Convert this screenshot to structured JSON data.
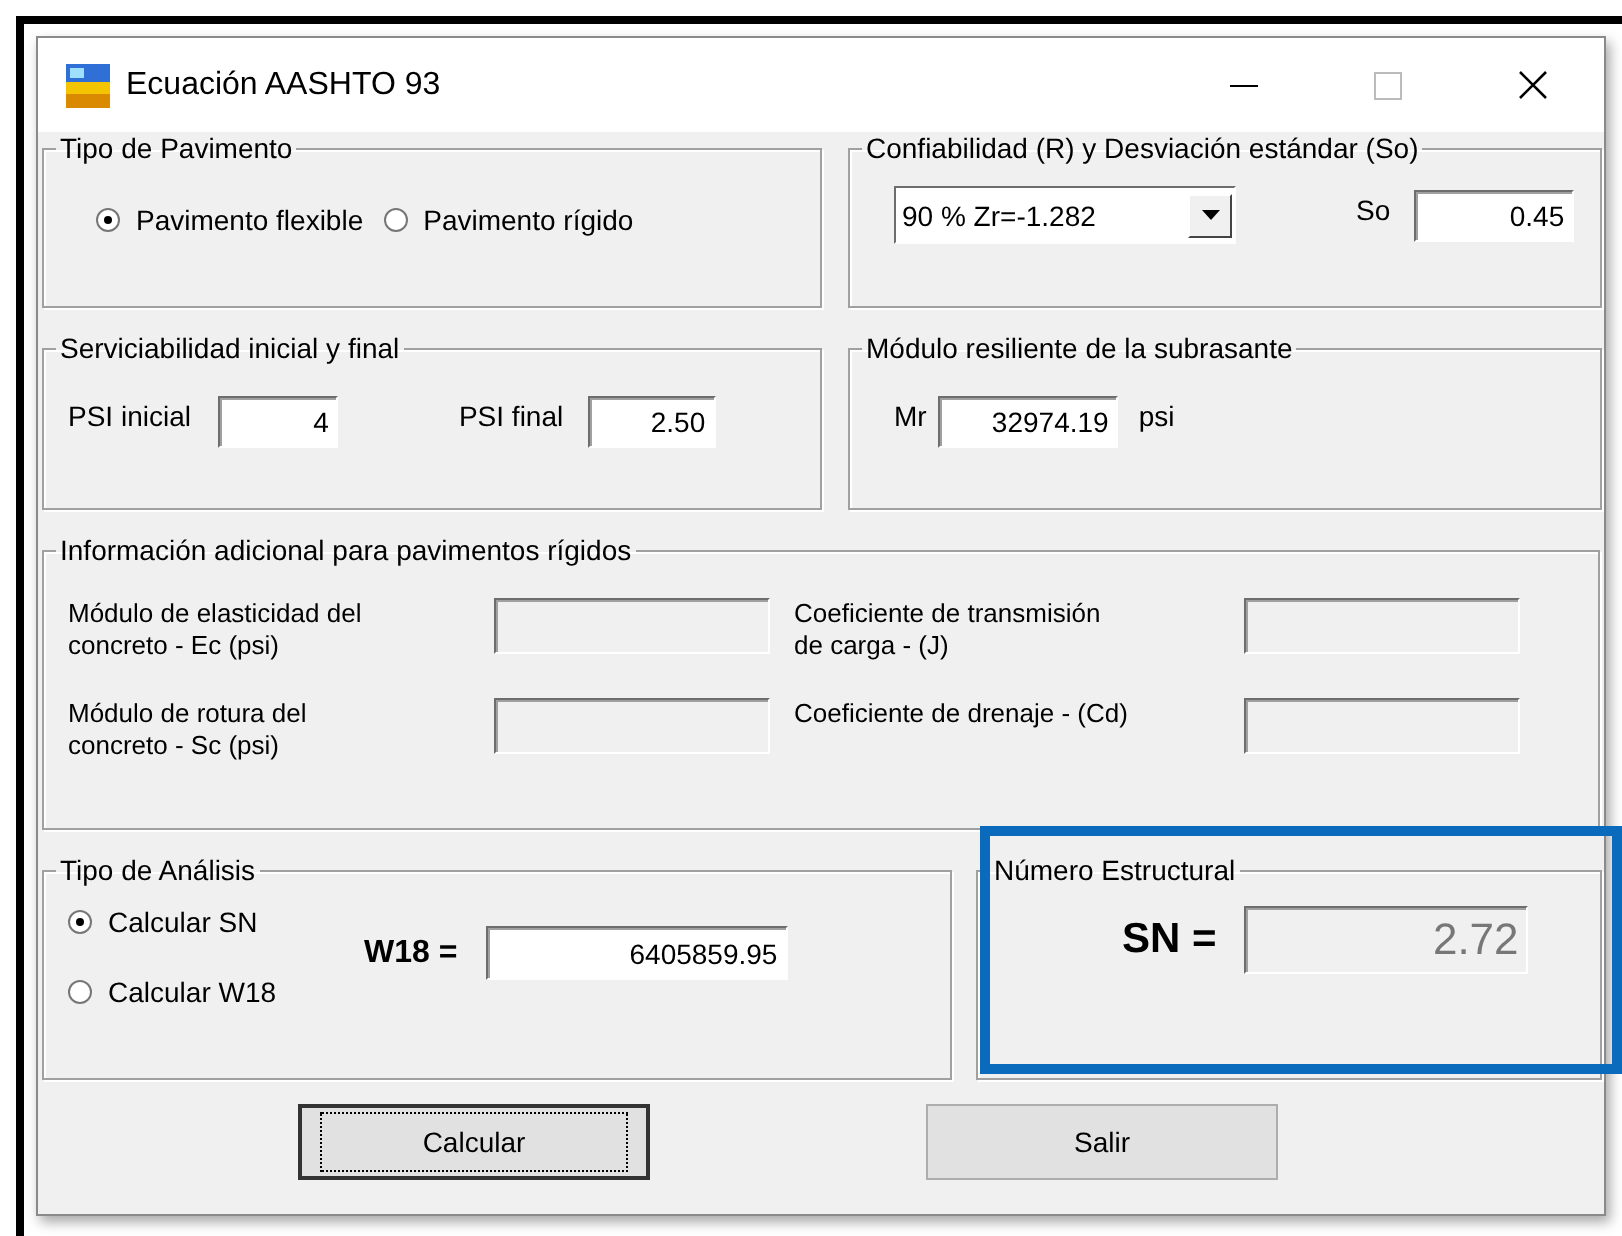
{
  "window": {
    "title": "Ecuación AASHTO 93"
  },
  "tipo_de_pavimento": {
    "title": "Tipo de Pavimento",
    "options": [
      {
        "label": "Pavimento flexible",
        "selected": true
      },
      {
        "label": "Pavimento rígido",
        "selected": false
      }
    ]
  },
  "confiabilidad": {
    "title": "Confiabilidad (R) y Desviación estándar (So)",
    "dropdown": {
      "value": "90 %  Zr=-1.282"
    },
    "so": {
      "label": "So",
      "value": "0.45"
    }
  },
  "serviciabilidad": {
    "title": "Serviciabilidad inicial y final",
    "fields": [
      {
        "label": "PSI inicial",
        "value": "4"
      },
      {
        "label": "PSI final",
        "value": "2.50"
      }
    ]
  },
  "modulo_resiliente": {
    "title": "Módulo resiliente de la subrasante",
    "label": "Mr",
    "value": "32974.19",
    "unit": "psi"
  },
  "info_rigidos": {
    "title": "Información adicional para pavimentos rígidos",
    "fields": [
      {
        "label": "Módulo de elasticidad del concreto - Ec (psi)",
        "disabled": true
      },
      {
        "label": "Coeficiente de transmisión de carga - (J)",
        "disabled": true
      },
      {
        "label": "Módulo de rotura del concreto - Sc (psi)",
        "disabled": true
      },
      {
        "label": "Coeficiente de drenaje - (Cd)",
        "disabled": true
      }
    ]
  },
  "tipo_de_analisis": {
    "title": "Tipo de Análisis",
    "options": [
      {
        "label": "Calcular SN",
        "selected": true
      },
      {
        "label": "Calcular W18",
        "selected": false
      }
    ],
    "w18": {
      "label": "W18 =",
      "value": "6405859.95"
    }
  },
  "numero_estructural": {
    "title": "Número Estructural",
    "label": "SN =",
    "value": "2.72",
    "disabled": true
  },
  "buttons": [
    {
      "label": "Calcular",
      "focused": true
    },
    {
      "label": "Salir",
      "focused": false
    }
  ]
}
